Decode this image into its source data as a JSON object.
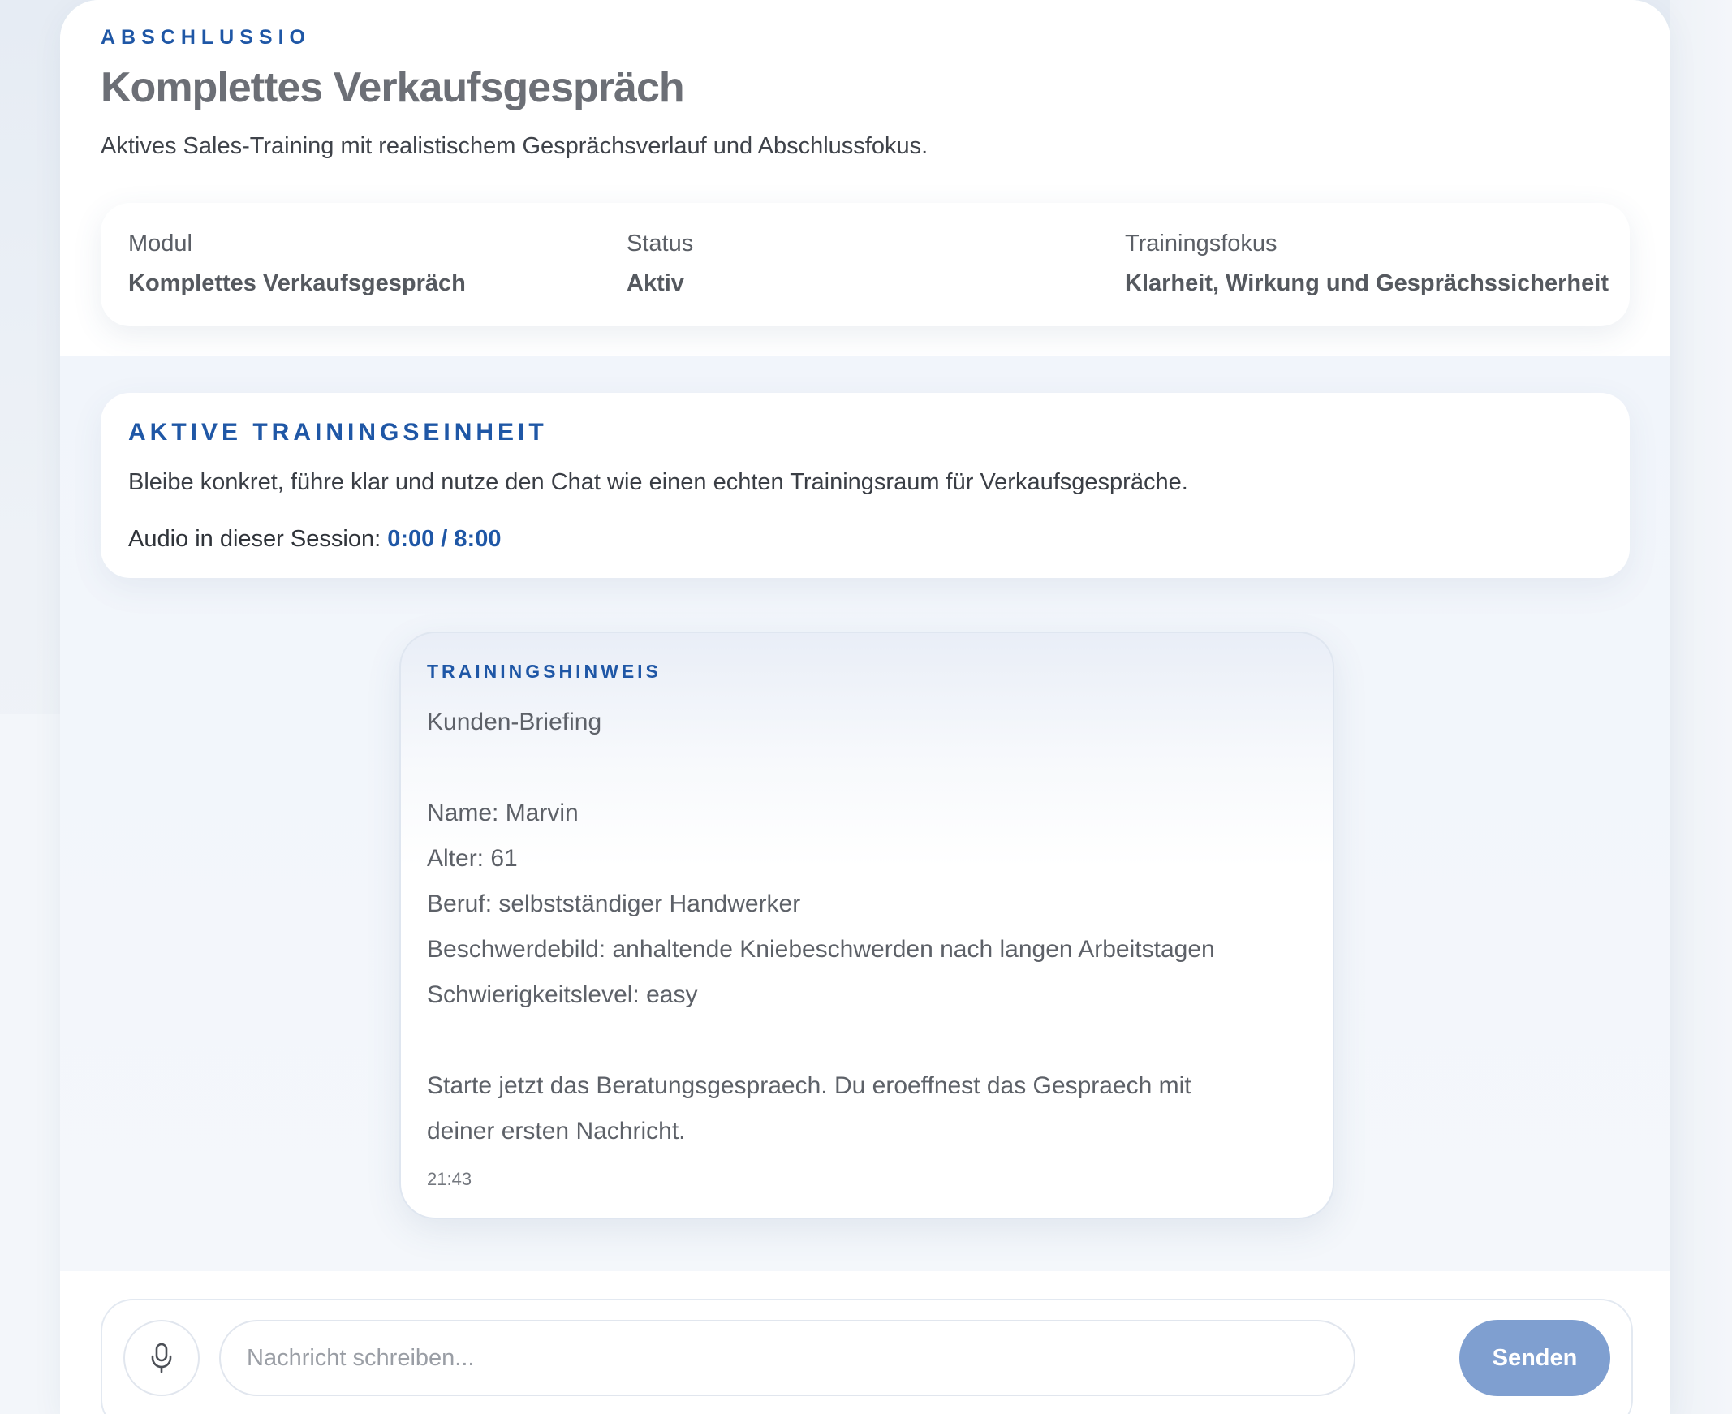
{
  "header": {
    "brand": "ABSCHLUSSIO",
    "title": "Komplettes Verkaufsgespräch",
    "subtitle": "Aktives Sales-Training mit realistischem Gesprächsverlauf und Abschlussfokus."
  },
  "info": {
    "module_label": "Modul",
    "module_value": "Komplettes Verkaufsgespräch",
    "status_label": "Status",
    "status_value": "Aktiv",
    "focus_label": "Trainingsfokus",
    "focus_value": "Klarheit, Wirkung und Gesprächssicherheit"
  },
  "session": {
    "heading": "AKTIVE TRAININGSEINHEIT",
    "description": "Bleibe konkret, führe klar und nutze den Chat wie einen echten Trainingsraum für Verkaufsgespräche.",
    "audio_label": "Audio in dieser Session:",
    "audio_time": "0:00 / 8:00"
  },
  "message": {
    "label": "TRAININGSHINWEIS",
    "title": "Kunden-Briefing",
    "name": "Name: Marvin",
    "age": "Alter: 61",
    "job": "Beruf: selbstständiger Handwerker",
    "complaint": "Beschwerdebild: anhaltende Kniebeschwerden nach langen Arbeitstagen",
    "difficulty": "Schwierigkeitslevel: easy",
    "instruction_1": "Starte jetzt das Beratungsgespraech. Du eroeffnest das Gespraech mit",
    "instruction_2": "deiner ersten Nachricht.",
    "time": "21:43"
  },
  "composer": {
    "placeholder": "Nachricht schreiben...",
    "value": "",
    "send_label": "Senden",
    "mic_icon": "microphone-icon"
  },
  "colors": {
    "accent": "#1f57a6",
    "send_button": "#7f9fd0"
  }
}
